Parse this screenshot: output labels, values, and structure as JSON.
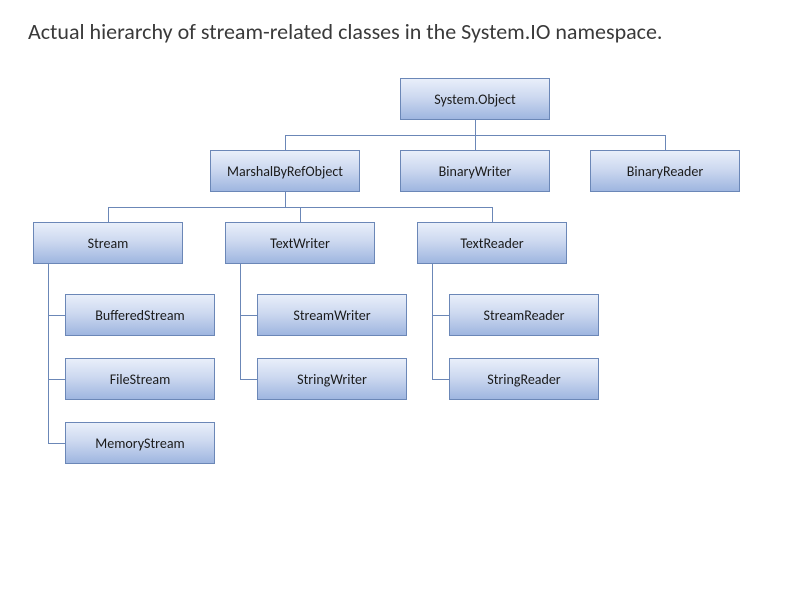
{
  "title": "Actual hierarchy of stream-related classes in the System.IO namespace.",
  "nodes": {
    "root": "System.Object",
    "marshal": "MarshalByRefObject",
    "binWriter": "BinaryWriter",
    "binReader": "BinaryReader",
    "stream": "Stream",
    "textWriter": "TextWriter",
    "textReader": "TextReader",
    "bufStream": "BufferedStream",
    "fileStream": "FileStream",
    "memStream": "MemoryStream",
    "strmWriter": "StreamWriter",
    "strWriter": "StringWriter",
    "strmReader": "StreamReader",
    "strReader": "StringReader"
  },
  "hierarchy": {
    "System.Object": [
      "MarshalByRefObject",
      "BinaryWriter",
      "BinaryReader"
    ],
    "MarshalByRefObject": [
      "Stream",
      "TextWriter",
      "TextReader"
    ],
    "Stream": [
      "BufferedStream",
      "FileStream",
      "MemoryStream"
    ],
    "TextWriter": [
      "StreamWriter",
      "StringWriter"
    ],
    "TextReader": [
      "StreamReader",
      "StringReader"
    ]
  }
}
